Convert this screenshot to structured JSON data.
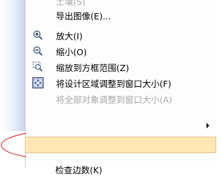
{
  "menu": {
    "items": [
      {
        "label": "土壤(S)",
        "disabled": true
      },
      {
        "label": "导出图像(E)...",
        "disabled": false
      },
      {
        "label": "放大(I)",
        "icon": "zoom-in-icon",
        "disabled": false
      },
      {
        "label": "缩小(O)",
        "icon": "zoom-out-icon",
        "disabled": false
      },
      {
        "label": "缩放到方框范围(Z)",
        "icon": "zoom-box-icon",
        "disabled": false
      },
      {
        "label": "将设计区域调整到窗口大小(F)",
        "icon": "fit-window-icon",
        "disabled": false
      },
      {
        "label": "将全部对象调整到窗口大小(A)",
        "disabled": true
      }
    ],
    "bottom_item_label": "检查边数(K)"
  },
  "colors": {
    "highlight": "#ffe8b3",
    "annotation": "#d33"
  }
}
